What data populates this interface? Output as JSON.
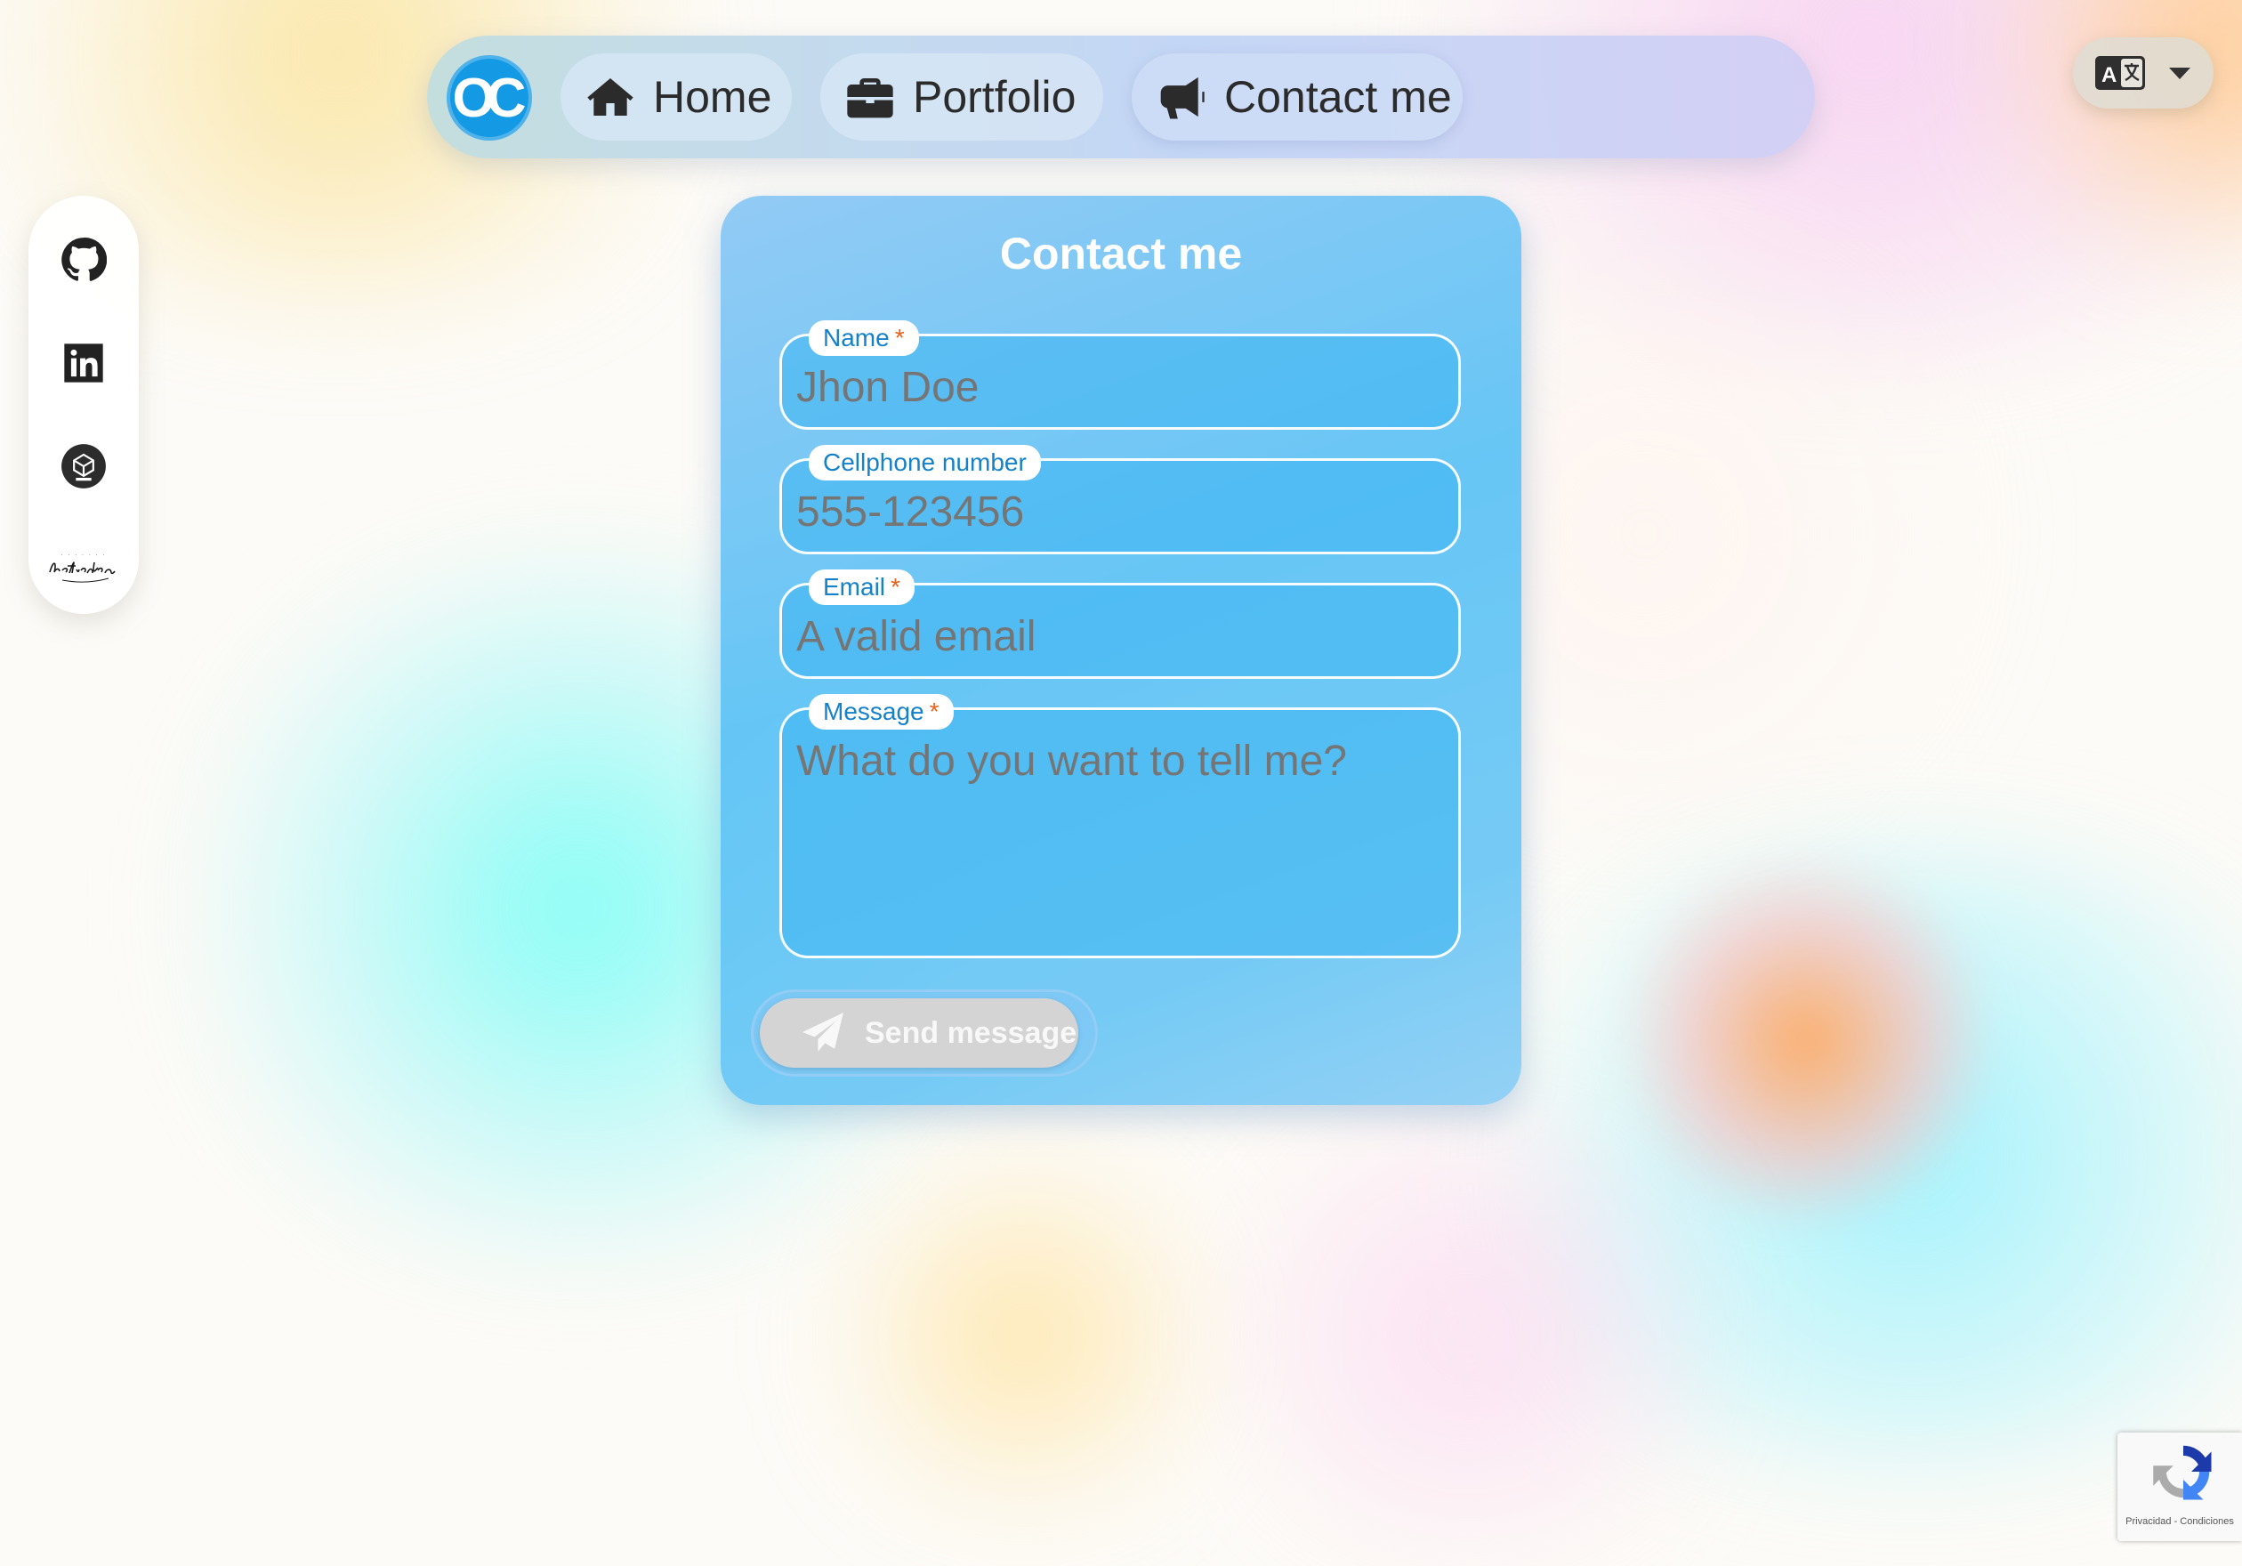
{
  "nav": {
    "logo_text": "OC",
    "items": [
      {
        "label": "Home",
        "icon": "home-icon"
      },
      {
        "label": "Portfolio",
        "icon": "briefcase-icon"
      },
      {
        "label": "Contact me",
        "icon": "megaphone-icon",
        "active": true
      }
    ]
  },
  "language": {
    "icon": "translate-icon",
    "toggle_icon": "caret-down-icon"
  },
  "social": [
    {
      "name": "GitHub",
      "icon": "github-icon"
    },
    {
      "name": "LinkedIn",
      "icon": "linkedin-icon"
    },
    {
      "name": "beat",
      "icon": "beat-logo-icon"
    },
    {
      "name": "la tienda",
      "icon": "la-tienda-logo-icon"
    }
  ],
  "form": {
    "title": "Contact me",
    "fields": {
      "name": {
        "label": "Name",
        "required_mark": "*",
        "placeholder": "Jhon Doe"
      },
      "phone": {
        "label": "Cellphone number",
        "placeholder": "555-123456"
      },
      "email": {
        "label": "Email",
        "required_mark": "*",
        "placeholder": "A valid email"
      },
      "message": {
        "label": "Message",
        "required_mark": "*",
        "placeholder": "What do you want to tell me?"
      }
    },
    "send_label": "Send message"
  },
  "recaptcha": {
    "footer": "Privacidad - Condiciones"
  },
  "colors": {
    "accent": "#1499e4",
    "label_text": "#1581c9",
    "required": "#e8621c"
  }
}
